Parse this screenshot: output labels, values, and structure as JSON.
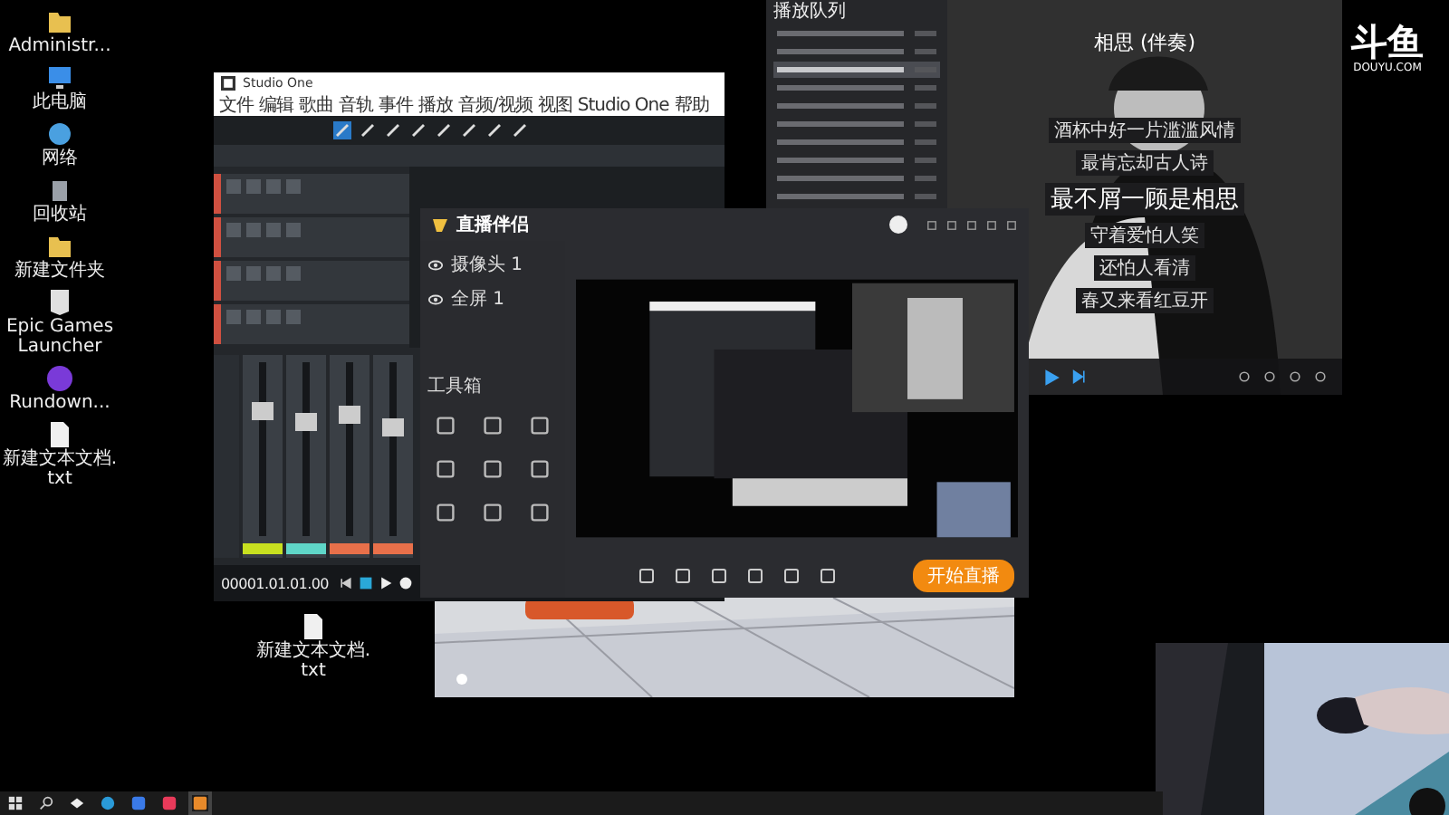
{
  "desktop_icons": [
    {
      "label": "Administr...",
      "kind": "user-folder"
    },
    {
      "label": "此电脑",
      "kind": "pc"
    },
    {
      "label": "网络",
      "kind": "network"
    },
    {
      "label": "回收站",
      "kind": "bin"
    },
    {
      "label": "新建文件夹",
      "kind": "folder"
    },
    {
      "label": "Epic Games Launcher",
      "kind": "epic"
    },
    {
      "label": "Rundown...",
      "kind": "app"
    },
    {
      "label": "新建文本文档.txt",
      "kind": "file"
    }
  ],
  "daw": {
    "title": "Studio One",
    "menu": [
      "文件",
      "编辑",
      "歌曲",
      "音轨",
      "事件",
      "播放",
      "音频/视频",
      "视图",
      "Studio One",
      "帮助"
    ],
    "tracks": [
      {
        "muted": false
      },
      {
        "muted": false
      },
      {
        "muted": false
      },
      {
        "muted": false
      }
    ],
    "channels": [
      {
        "level": 0.72,
        "color": "#c8e020"
      },
      {
        "level": 0.66,
        "color": "#5fd6c8"
      },
      {
        "level": 0.7,
        "color": "#e8704a"
      },
      {
        "level": 0.62,
        "color": "#e8704a"
      }
    ],
    "time": "00001.01.01.00"
  },
  "player": {
    "queue_title": "播放队列",
    "queue_rows": [
      {
        "selected": false
      },
      {
        "selected": false
      },
      {
        "selected": true
      },
      {
        "selected": false
      },
      {
        "selected": false
      },
      {
        "selected": false
      },
      {
        "selected": false
      },
      {
        "selected": false
      },
      {
        "selected": false
      },
      {
        "selected": false
      }
    ],
    "song": "相思 (伴奏)",
    "lyrics": [
      {
        "text": "酒杯中好一片滥滥风情",
        "current": false
      },
      {
        "text": "最肯忘却古人诗",
        "current": false
      },
      {
        "text": "最不屑一顾是相思",
        "current": true
      },
      {
        "text": "守着爱怕人笑",
        "current": false
      },
      {
        "text": "还怕人看清",
        "current": false
      },
      {
        "text": "春又来看红豆开",
        "current": false
      }
    ]
  },
  "logo": {
    "mark": "斗鱼",
    "site": "DOUYU.COM"
  },
  "streamer": {
    "app_name": "直播伴侣",
    "sources": [
      {
        "label": "摄像头 1",
        "visible": true
      },
      {
        "label": "全屏 1",
        "visible": true
      }
    ],
    "toolbox_title": "工具箱",
    "start_button": "开始直播"
  },
  "desktop_file": {
    "label": "新建文本文档.txt"
  }
}
